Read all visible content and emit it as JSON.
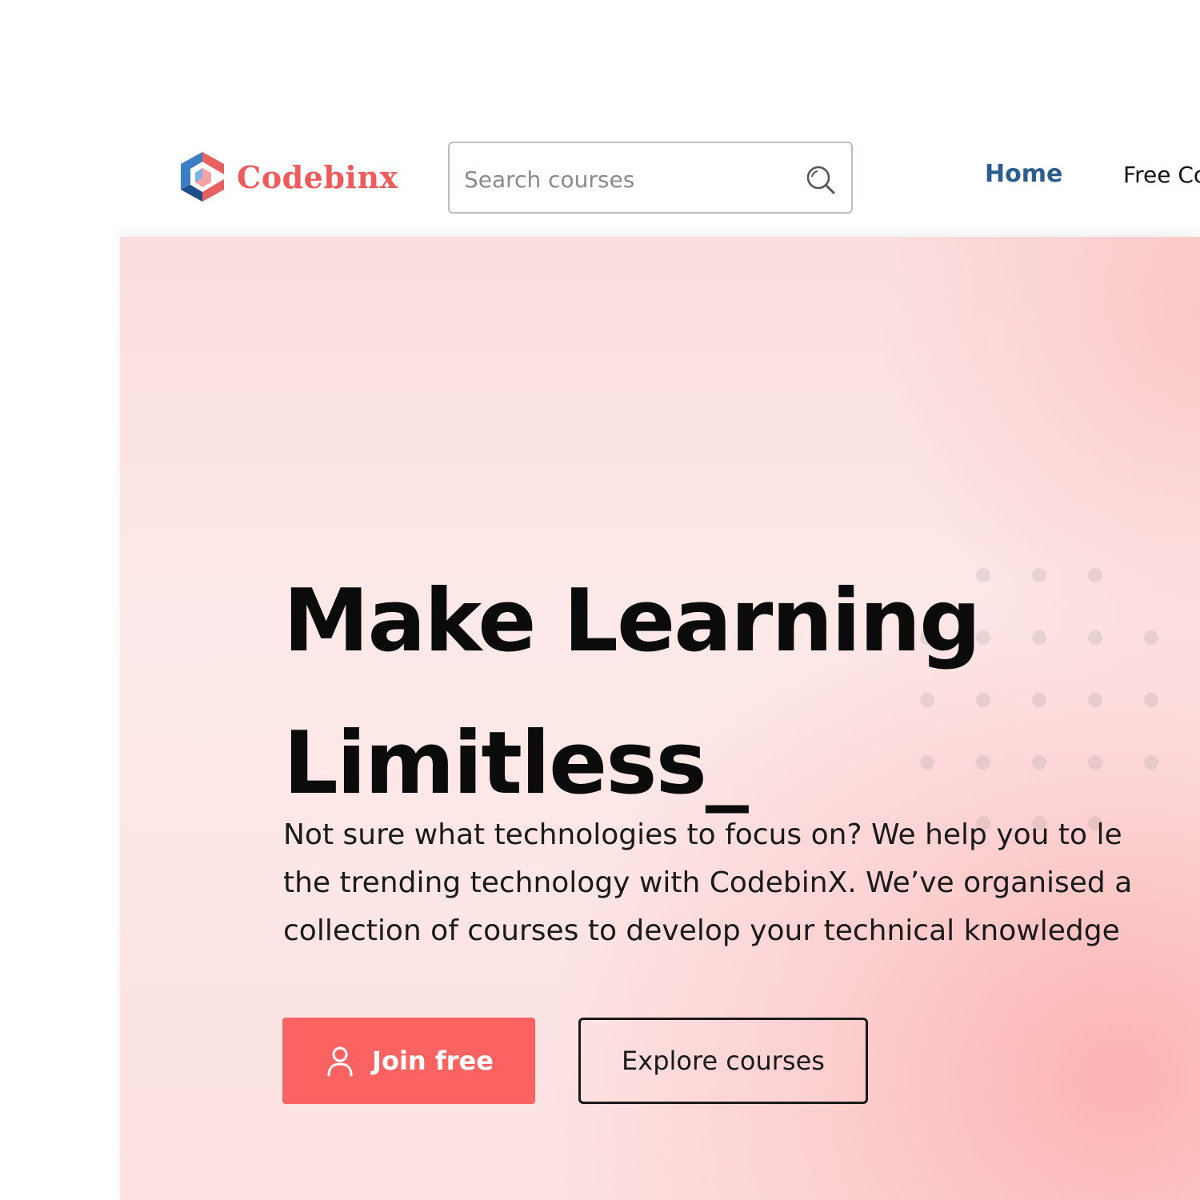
{
  "brand": {
    "name": "Codebinx",
    "color": "#ef5b5b"
  },
  "search": {
    "placeholder": "Search courses",
    "value": "",
    "icon": "search-icon"
  },
  "nav": {
    "items": [
      {
        "label": "Home",
        "active": true,
        "color": "#2b5d8f"
      },
      {
        "label": "Free Co",
        "active": false
      }
    ]
  },
  "hero": {
    "headline_line1": "Make Learning",
    "headline_line2": "Limitless_",
    "subtext_line1": "Not sure what technologies to focus on? We help you to le",
    "subtext_line2": "the trending technology with CodebinX. We’ve organised a",
    "subtext_line3": "collection of courses to develop your technical knowledge",
    "join_label": "Join free",
    "join_icon": "user-icon",
    "explore_label": "Explore courses",
    "accent_color": "#fb6363"
  }
}
